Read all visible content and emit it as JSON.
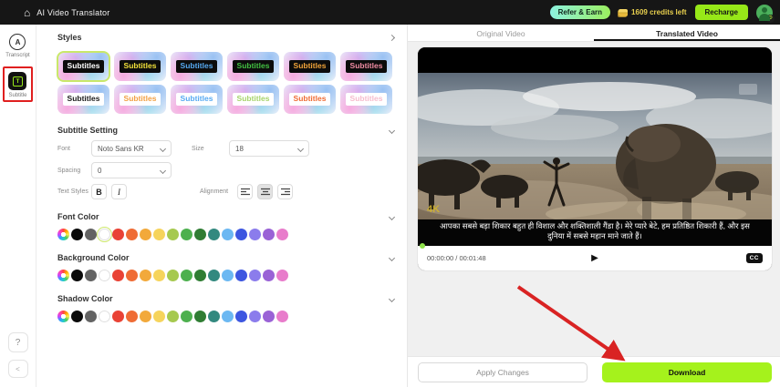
{
  "topbar": {
    "title": "AI Video Translator",
    "refer_button": "Refer & Earn",
    "credits": "1609 credits left",
    "recharge_button": "Recharge"
  },
  "sidebar": {
    "transcript_label": "Transcript",
    "transcript_icon_letter": "A",
    "subtitle_label": "Subtitle",
    "subtitle_icon_letter": "T",
    "help_label": "?",
    "collapse_label": "<"
  },
  "styles_section": {
    "title": "Styles",
    "thumbnails": [
      {
        "label": "Subtitles",
        "box": "dark",
        "color": "#ffffff",
        "selected": true
      },
      {
        "label": "Subtitles",
        "box": "dark",
        "color": "#f2e13a",
        "selected": false
      },
      {
        "label": "Subtitles",
        "box": "dark",
        "color": "#57aaf2",
        "selected": false
      },
      {
        "label": "Subtitles",
        "box": "dark",
        "color": "#43c243",
        "selected": false
      },
      {
        "label": "Subtitles",
        "box": "dark",
        "color": "#f2a43a",
        "selected": false
      },
      {
        "label": "Subtitles",
        "box": "dark",
        "color": "#f28da4",
        "selected": false
      },
      {
        "label": "Subtitles",
        "box": "light",
        "color": "#1c1c1c",
        "selected": false
      },
      {
        "label": "Subtitles",
        "box": "light",
        "color": "#f2a043",
        "selected": false
      },
      {
        "label": "Subtitles",
        "box": "light",
        "color": "#57aaf2",
        "selected": false
      },
      {
        "label": "Subtitles",
        "box": "light",
        "color": "#a6d36a",
        "selected": false
      },
      {
        "label": "Subtitles",
        "box": "light",
        "color": "#ef6c35",
        "selected": false
      },
      {
        "label": "Subtitles",
        "box": "light",
        "color": "#f6bccd",
        "selected": false
      }
    ]
  },
  "subtitle_setting": {
    "title": "Subtitle Setting",
    "font_label": "Font",
    "font_value": "Noto Sans KR",
    "size_label": "Size",
    "size_value": "18",
    "spacing_label": "Spacing",
    "spacing_value": "0",
    "text_styles_label": "Text Styles",
    "bold_label": "B",
    "italic_label": "I",
    "alignment_label": "Alignment",
    "alignment_active": "center"
  },
  "color_sections": [
    {
      "title": "Font Color",
      "selected_index": 3
    },
    {
      "title": "Background Color",
      "selected_index": -1
    },
    {
      "title": "Shadow Color",
      "selected_index": -1
    }
  ],
  "palette": [
    "rainbow",
    "#0a0a0a",
    "#636363",
    "#ffffff",
    "#e94235",
    "#ef6c35",
    "#f2a93b",
    "#f6d45c",
    "#a6c94f",
    "#4db04e",
    "#2f7d33",
    "#33897f",
    "#6cb8f2",
    "#3d56e0",
    "#8b7cec",
    "#9a62d6",
    "#e87ccb"
  ],
  "video_panel": {
    "tabs": [
      {
        "label": "Original Video",
        "active": false
      },
      {
        "label": "Translated Video",
        "active": true
      }
    ],
    "subtitle_text": "आपका सबसे बड़ा शिकार बहुत ही विशाल और शक्तिशाली गैंडा है। मेरे प्यारे बेटे, हम प्रतिष्ठित शिकारी हैं, और इस दुनिया में सबसे महान माने जाते हैं।",
    "time": "00:00:00 / 00:01:48",
    "play_icon": "▶",
    "cc_label": "CC",
    "watermark": "4K"
  },
  "footer": {
    "apply_button": "Apply Changes",
    "download_button": "Download"
  },
  "colors": {
    "accent_lime": "#a5f21c",
    "recharge_green": "#97e818",
    "credits_yellow": "#e8cf4e",
    "annotation_red": "#e01f1f",
    "selected_ring": "#c9e86a"
  }
}
